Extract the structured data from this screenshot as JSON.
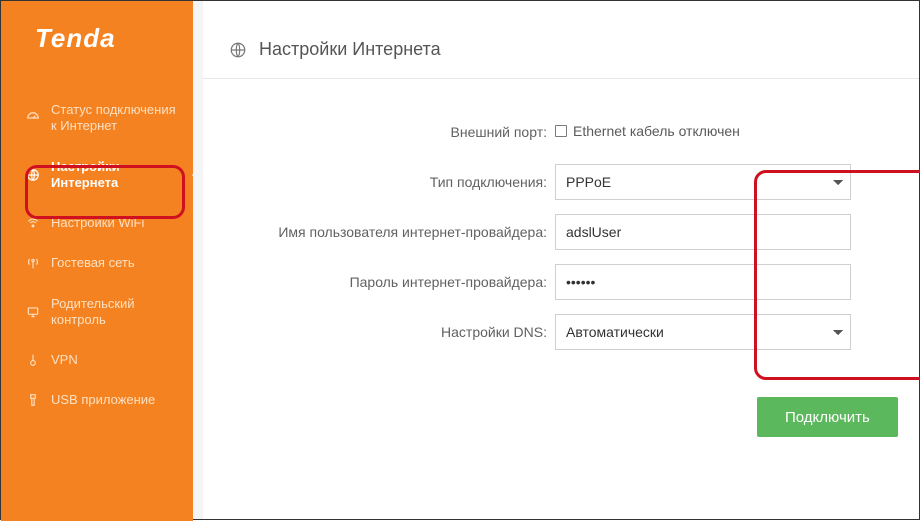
{
  "brand": "Tenda",
  "page": {
    "title": "Настройки Интернета"
  },
  "sidebar": {
    "items": [
      {
        "label": "Статус подключения к Интернет",
        "icon": "gauge-icon"
      },
      {
        "label": "Настройки Интернета",
        "icon": "globe-icon"
      },
      {
        "label": "Настройки WiFi",
        "icon": "wifi-icon"
      },
      {
        "label": "Гостевая сеть",
        "icon": "antenna-icon"
      },
      {
        "label": "Родительский контроль",
        "icon": "shield-icon"
      },
      {
        "label": "VPN",
        "icon": "vpn-icon"
      },
      {
        "label": "USB приложение",
        "icon": "usb-icon"
      }
    ]
  },
  "form": {
    "external_port": {
      "label": "Внешний порт:",
      "status": "Ethernet кабель отключен"
    },
    "conn_type": {
      "label": "Тип подключения:",
      "value": "PPPoE"
    },
    "isp_user": {
      "label": "Имя пользователя интернет-провайдера:",
      "value": "adslUser"
    },
    "isp_pass": {
      "label": "Пароль интернет-провайдера:",
      "value": "••••••"
    },
    "dns": {
      "label": "Настройки DNS:",
      "value": "Автоматически"
    },
    "connect_btn": "Подключить"
  }
}
